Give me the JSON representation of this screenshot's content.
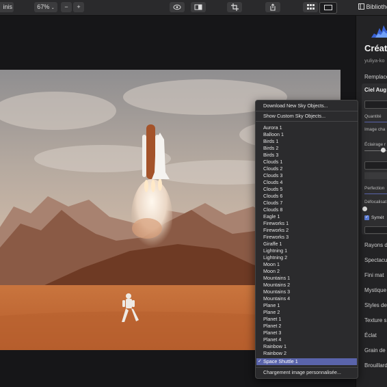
{
  "toolbar": {
    "back_label": "inis",
    "zoom": "67%",
    "zoom_out": "−",
    "zoom_in": "+",
    "library": "Bibliothè"
  },
  "sidebar": {
    "title": "Créat",
    "author": "yuliya-ko",
    "replace": "Remplace",
    "panel_title": "Ciel Aug",
    "quantity": "Quantité",
    "image_label": "Image cha",
    "lighting": "Éclairage r",
    "perfection": "Perfection",
    "defocus": "Défocalisat",
    "symmetry": "Symét",
    "items": [
      "Rayons d",
      "Spectacu",
      "Fini mat",
      "Mystique",
      "Styles de",
      "Texture s",
      "Éclat",
      "Grain de",
      "Brouillard"
    ]
  },
  "menu": {
    "download": "Download New Sky Objects...",
    "show_custom": "Show Custom Sky Objects...",
    "items": [
      "Aurora 1",
      "Balloon 1",
      "Birds 1",
      "Birds 2",
      "Birds 3",
      "Clouds 1",
      "Clouds 2",
      "Clouds 3",
      "Clouds 4",
      "Clouds 5",
      "Clouds 6",
      "Clouds 7",
      "Clouds 8",
      "Eagle 1",
      "Fireworks 1",
      "Fireworks 2",
      "Fireworks 3",
      "Giraffe 1",
      "Lightning 1",
      "Lightning 2",
      "Moon 1",
      "Moon 2",
      "Mountains 1",
      "Mountains 2",
      "Mountains 3",
      "Mountains 4",
      "Plane 1",
      "Plane 2",
      "Planet 1",
      "Planet 2",
      "Planet 3",
      "Planet 4",
      "Rainbow 1",
      "Rainbow 2",
      "Space Shuttle 1"
    ],
    "selected": "Space Shuttle 1",
    "load_custom": "Chargement image personnalisée..."
  },
  "colors": {
    "selection": "#5a64ab",
    "checkbox": "#5a7bd6"
  }
}
